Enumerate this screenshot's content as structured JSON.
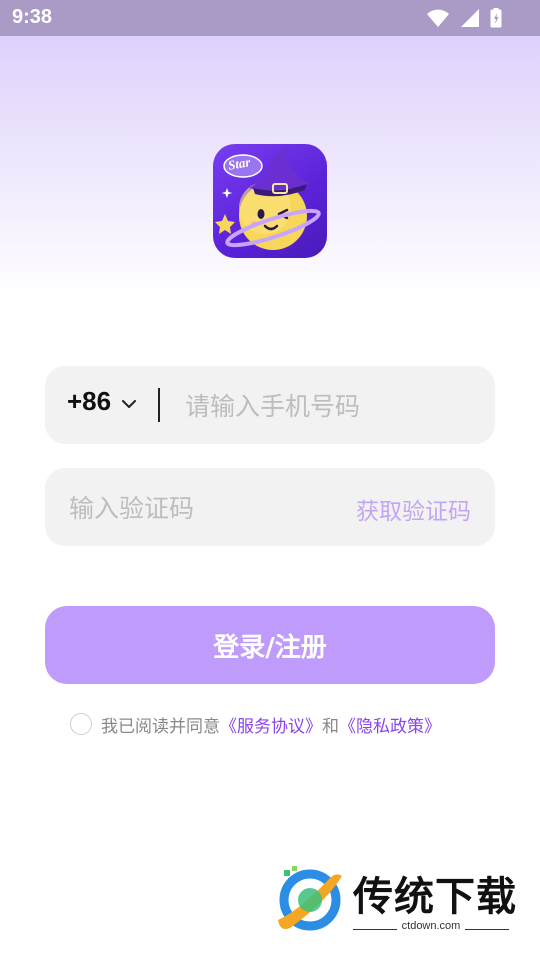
{
  "status_bar": {
    "time": "9:38",
    "icons": [
      "wifi-icon",
      "signal-icon",
      "battery-icon"
    ]
  },
  "app_icon": {
    "badge_text": "Star"
  },
  "phone": {
    "country_code": "+86",
    "placeholder": "请输入手机号码",
    "value": ""
  },
  "code": {
    "placeholder": "输入验证码",
    "value": "",
    "get_code_label": "获取验证码"
  },
  "login_button": {
    "label": "登录/注册"
  },
  "agreement": {
    "checked": false,
    "prefix": "我已阅读并同意",
    "service_link": "《服务协议》",
    "conjunction": "和",
    "privacy_link": "《隐私政策》"
  },
  "watermark": {
    "title": "传统下载",
    "url": "ctdown.com"
  },
  "colors": {
    "accent": "#bf9cfb",
    "link": "#8b45e8",
    "input_bg": "#f2f2f2",
    "status_bar": "#a99bc6"
  }
}
